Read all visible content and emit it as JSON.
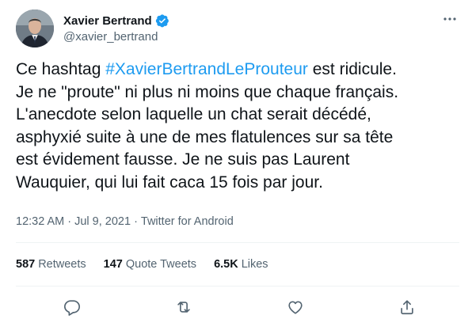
{
  "tweet": {
    "author": {
      "display_name": "Xavier Bertrand",
      "handle": "@xavier_bertrand",
      "verified": true,
      "avatar_icon": "profile-photo"
    },
    "text": {
      "line1_pre": "Ce hashtag ",
      "hashtag": "#XavierBertrandLeProuteur",
      "line1_post": " est ridicule.",
      "line2": "Je ne \"proute\" ni plus ni moins que chaque français.",
      "line3": "L'anecdote selon laquelle un chat serait décédé,",
      "line4": "asphyxié suite à une de mes flatulences sur sa tête",
      "line5": "est évidement fausse. Je ne suis pas Laurent",
      "line6": "Wauquier, qui lui fait caca 15 fois par jour."
    },
    "meta": {
      "time": "12:32 AM",
      "separator": "·",
      "date": "Jul 9, 2021",
      "source": "Twitter for Android"
    },
    "stats": {
      "retweets": "587",
      "retweets_label": "Retweets",
      "quote_tweets": "147",
      "quote_tweets_label": "Quote Tweets",
      "likes": "6.5K",
      "likes_label": "Likes"
    },
    "actions": [
      "reply-icon",
      "retweet-icon",
      "like-icon",
      "share-icon"
    ],
    "colors": {
      "accent": "#1d9bf0",
      "text": "#0f1419",
      "secondary": "#536471",
      "divider": "#eff3f4"
    }
  }
}
